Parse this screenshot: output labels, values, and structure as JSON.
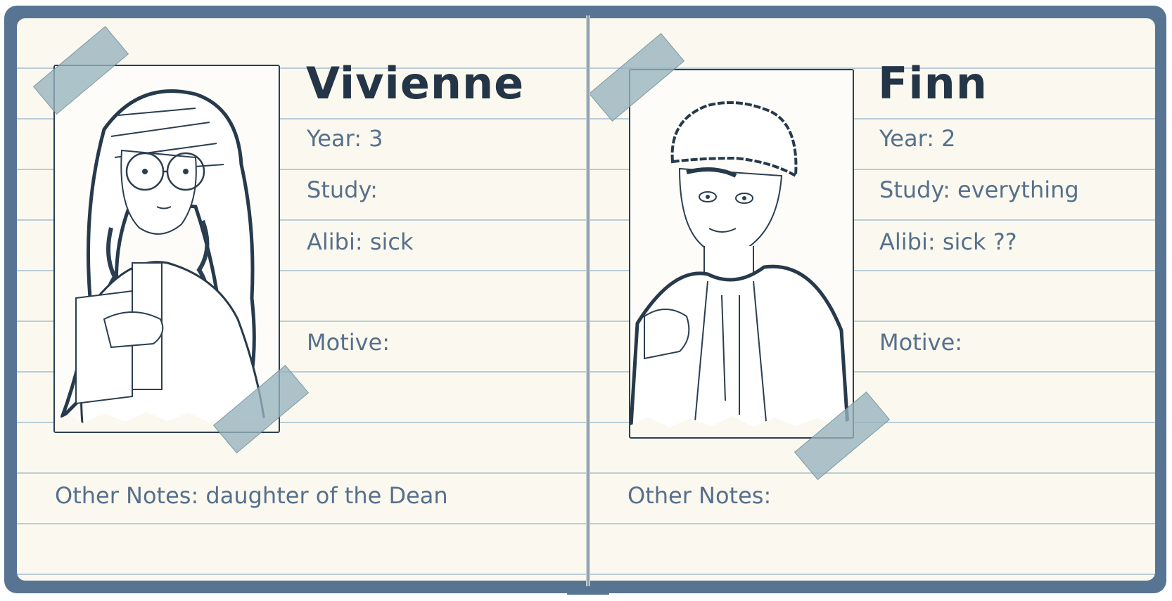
{
  "notebook": {
    "colors": {
      "cover": "#577592",
      "paper": "#fbf9ef",
      "ink": "#233547",
      "handwriting": "#56708c",
      "rule": "#b9cdd7",
      "tape": "#96b2bc"
    }
  },
  "suspects": [
    {
      "name": "Vivienne",
      "year_line": "Year: 3",
      "study_line": "Study:",
      "alibi_line": "Alibi: sick",
      "motive_line": "Motive:",
      "notes_line": "Other Notes:  daughter of the Dean",
      "portrait_icon": "girl-with-glasses-and-braids-sketch"
    },
    {
      "name": "Finn",
      "year_line": "Year: 2",
      "study_line": "Study: everything",
      "alibi_line": "Alibi: sick ??",
      "motive_line": "Motive:",
      "notes_line": "Other Notes:",
      "portrait_icon": "boy-with-curly-hair-and-hoodie-sketch"
    }
  ]
}
